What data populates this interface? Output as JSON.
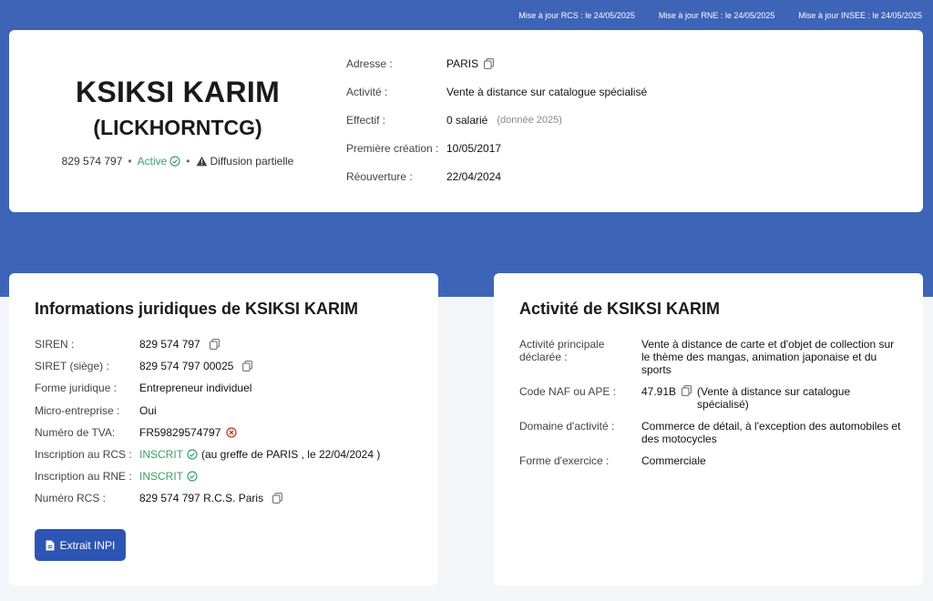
{
  "updates": {
    "rcs": "Mise à jour RCS : le 24/05/2025",
    "rne": "Mise à jour RNE : le 24/05/2025",
    "insee": "Mise à jour INSEE : le 24/05/2025"
  },
  "hero": {
    "name": "KSIKSI KARIM",
    "alias": "(LICKHORNTCG)",
    "siren": "829 574 797",
    "sep": "•",
    "status": "Active",
    "diffusion": "Diffusion partielle",
    "rows": [
      {
        "label": "Adresse :",
        "value": "PARIS"
      },
      {
        "label": "Activité :",
        "value": "Vente à distance sur catalogue spécialisé"
      },
      {
        "label": "Effectif :",
        "value": "0 salarié",
        "note": "(donnée 2025)"
      },
      {
        "label": "Première création :",
        "value": "10/05/2017"
      },
      {
        "label": "Réouverture :",
        "value": "22/04/2024"
      }
    ]
  },
  "juridique": {
    "title": "Informations juridiques de KSIKSI KARIM",
    "rows": [
      {
        "label": "SIREN :",
        "value": "829 574 797"
      },
      {
        "label": "SIRET (siège) :",
        "value": "829 574 797 00025"
      },
      {
        "label": "Forme juridique :",
        "value": "Entrepreneur individuel"
      },
      {
        "label": "Micro-entreprise :",
        "value": "Oui"
      },
      {
        "label": "Numéro de TVA:",
        "value": "FR59829574797"
      },
      {
        "label": "Inscription au RCS :",
        "value": "INSCRIT",
        "extra": "(au greffe de PARIS , le 22/04/2024 )"
      },
      {
        "label": "Inscription au RNE :",
        "value": "INSCRIT"
      },
      {
        "label": "Numéro RCS :",
        "value": "829 574 797 R.C.S. Paris"
      }
    ],
    "button": "Extrait INPI"
  },
  "activite": {
    "title": "Activité de KSIKSI KARIM",
    "rows": [
      {
        "label": "Activité principale déclarée :",
        "value": "Vente à distance de carte et d'objet de collection sur le thème des mangas, animation japonaise et du sports"
      },
      {
        "label": "Code NAF ou APE :",
        "value": "47.91B",
        "extra": "(Vente à distance sur catalogue spécialisé)"
      },
      {
        "label": "Domaine d'activité :",
        "value": "Commerce de détail, à l'exception des automobiles et des motocycles"
      },
      {
        "label": "Forme d'exercice :",
        "value": "Commerciale"
      }
    ]
  },
  "colors": {
    "band": "#3e64b8",
    "active": "#3aa06b",
    "button": "#2d55b3",
    "error": "#c0392b"
  },
  "icons": [
    "copy-icon",
    "check-circle-icon",
    "warning-icon",
    "x-circle-icon",
    "document-icon"
  ]
}
